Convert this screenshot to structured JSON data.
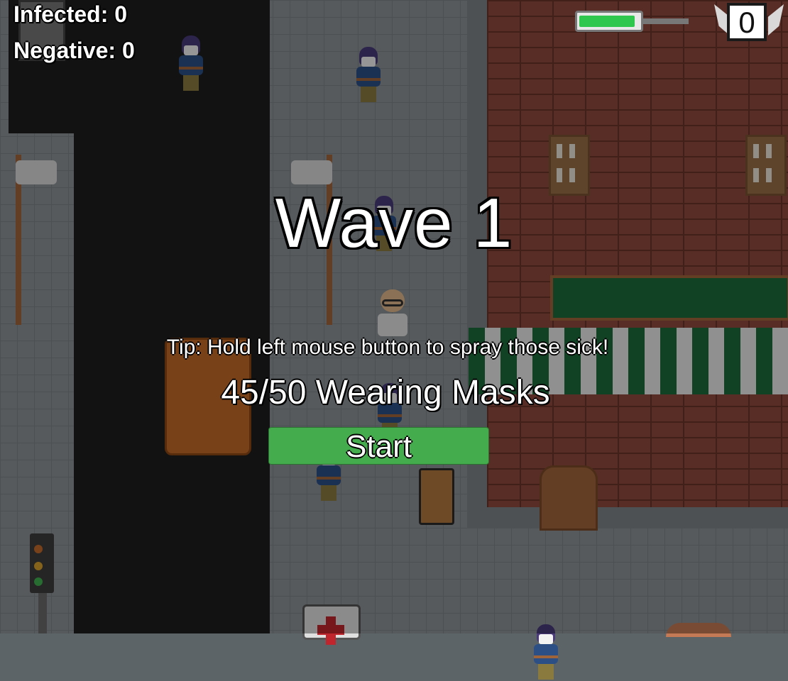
{
  "hud": {
    "infected_label": "Infected: 0",
    "negative_label": "Negative: 0",
    "health_fraction": 0.93,
    "score_badge_value": "0"
  },
  "wave_screen": {
    "title": "Wave 1",
    "tip": "Tip: Hold left mouse button to spray those sick!",
    "masks_status": "45/50 Wearing Masks",
    "start_label": "Start"
  },
  "colors": {
    "health_fill": "#30c74f",
    "start_button": "#45ac4d",
    "awning_green": "#1e6b3a"
  }
}
